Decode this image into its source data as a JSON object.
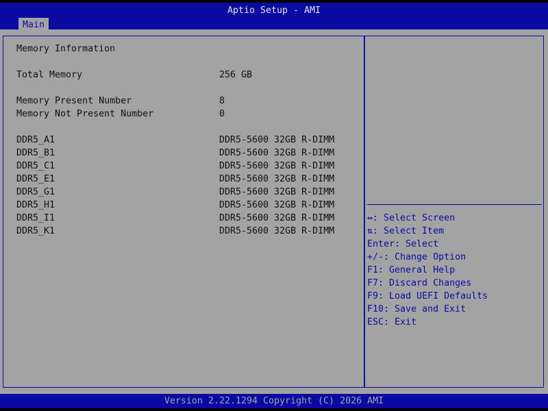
{
  "window": {
    "title": "Aptio Setup - AMI"
  },
  "tabs": [
    {
      "label": "Main"
    }
  ],
  "main": {
    "section_title": "Memory Information",
    "total_memory": {
      "label": "Total Memory",
      "value": "256 GB"
    },
    "present_number": {
      "label": "Memory Present Number",
      "value": "8"
    },
    "not_present_number": {
      "label": "Memory Not Present Number",
      "value": "0"
    },
    "slots": [
      {
        "label": "DDR5_A1",
        "value": "DDR5-5600 32GB R-DIMM"
      },
      {
        "label": "DDR5_B1",
        "value": "DDR5-5600 32GB R-DIMM"
      },
      {
        "label": "DDR5_C1",
        "value": "DDR5-5600 32GB R-DIMM"
      },
      {
        "label": "DDR5_E1",
        "value": "DDR5-5600 32GB R-DIMM"
      },
      {
        "label": "DDR5_G1",
        "value": "DDR5-5600 32GB R-DIMM"
      },
      {
        "label": "DDR5_H1",
        "value": "DDR5-5600 32GB R-DIMM"
      },
      {
        "label": "DDR5_I1",
        "value": "DDR5-5600 32GB R-DIMM"
      },
      {
        "label": "DDR5_K1",
        "value": "DDR5-5600 32GB R-DIMM"
      }
    ]
  },
  "help": [
    "↔: Select Screen",
    "⇅: Select Item",
    "Enter: Select",
    "+/-: Change Option",
    "F1: General Help",
    "F7: Discard Changes",
    "F9: Load UEFI Defaults",
    "F10: Save and Exit",
    "ESC: Exit"
  ],
  "footer": {
    "text": "Version 2.22.1294 Copyright (C) 2026 AMI"
  },
  "colors": {
    "background": "#a3a3a3",
    "accent": "#0b0ba4",
    "text": "#101010"
  }
}
